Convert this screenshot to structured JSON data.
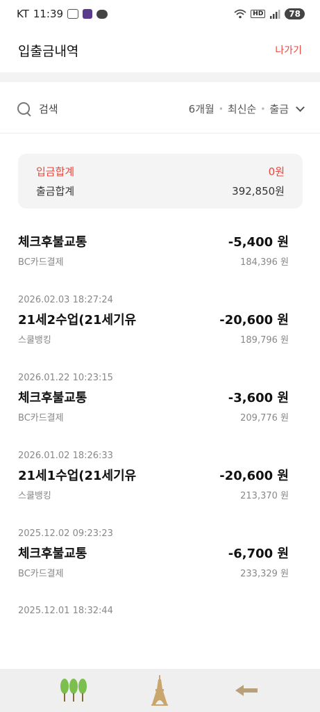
{
  "status_bar": {
    "carrier": "KT",
    "time": "11:39",
    "hd_label": "HD",
    "battery": "78"
  },
  "header": {
    "title": "입출금내역",
    "exit_label": "나가기"
  },
  "search": {
    "label": "검색",
    "filter_period": "6개월",
    "filter_sort": "최신순",
    "filter_type": "출금"
  },
  "summary": {
    "deposit_label": "입금합계",
    "deposit_value": "0원",
    "withdraw_label": "출금합계",
    "withdraw_value": "392,850원"
  },
  "transactions": [
    {
      "date": "",
      "title": "체크후불교통",
      "amount": "-5,400 원",
      "method": "BC카드결제",
      "balance": "184,396 원"
    },
    {
      "date": "2026.02.03 18:27:24",
      "title": "21세2수업(21세기유",
      "amount": "-20,600 원",
      "method": "스쿨뱅킹",
      "balance": "189,796 원"
    },
    {
      "date": "2026.01.22 10:23:15",
      "title": "체크후불교통",
      "amount": "-3,600 원",
      "method": "BC카드결제",
      "balance": "209,776 원"
    },
    {
      "date": "2026.01.02 18:26:33",
      "title": "21세1수업(21세기유",
      "amount": "-20,600 원",
      "method": "스쿨뱅킹",
      "balance": "213,370 원"
    },
    {
      "date": "2025.12.02 09:23:23",
      "title": "체크후불교통",
      "amount": "-6,700 원",
      "method": "BC카드결제",
      "balance": "233,329 원"
    }
  ],
  "tail_date": "2025.12.01 18:32:44",
  "colors": {
    "accent_red": "#e8453c",
    "tree_green": "#7cbf4e",
    "tower_tan": "#c9a66b",
    "arrow_tan": "#b8a07a"
  },
  "bottom_nav": {
    "icons": [
      "trees-icon",
      "eiffel-tower-icon",
      "back-arrow-icon"
    ]
  }
}
